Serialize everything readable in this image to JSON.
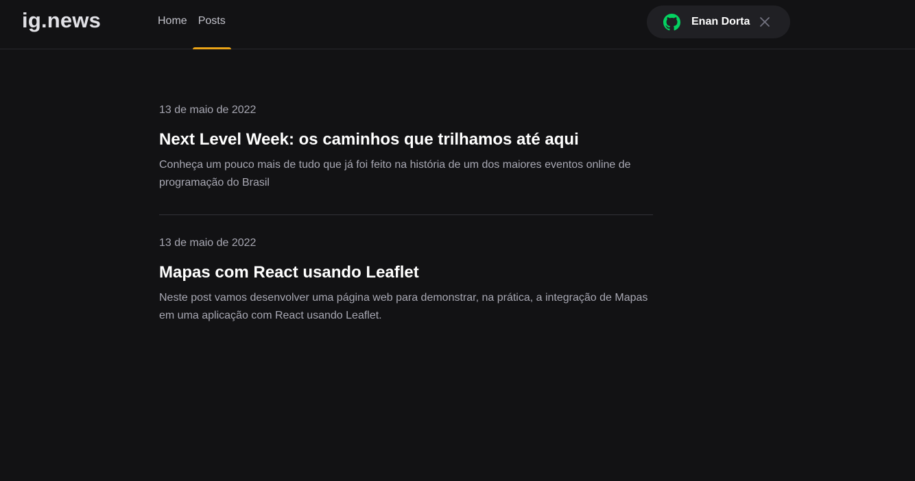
{
  "header": {
    "logo": "ig.news",
    "nav": [
      {
        "label": "Home",
        "active": false
      },
      {
        "label": "Posts",
        "active": true
      }
    ],
    "user": {
      "name": "Enan Dorta",
      "icon": "github-icon",
      "close_icon": "close-icon"
    }
  },
  "posts": [
    {
      "date": "13 de maio de 2022",
      "title": "Next Level Week: os caminhos que trilhamos até aqui",
      "excerpt": "Conheça um pouco mais de tudo que já foi feito na história de um dos maiores eventos online de programação do Brasil"
    },
    {
      "date": "13 de maio de 2022",
      "title": "Mapas com React usando Leaflet",
      "excerpt": "Neste post vamos desenvolver uma página web para demonstrar, na prática, a integração de Mapas em uma aplicação com React usando Leaflet."
    }
  ],
  "colors": {
    "background": "#121214",
    "accent": "#eba417",
    "github_green": "#04d361",
    "button_bg": "#202024"
  }
}
